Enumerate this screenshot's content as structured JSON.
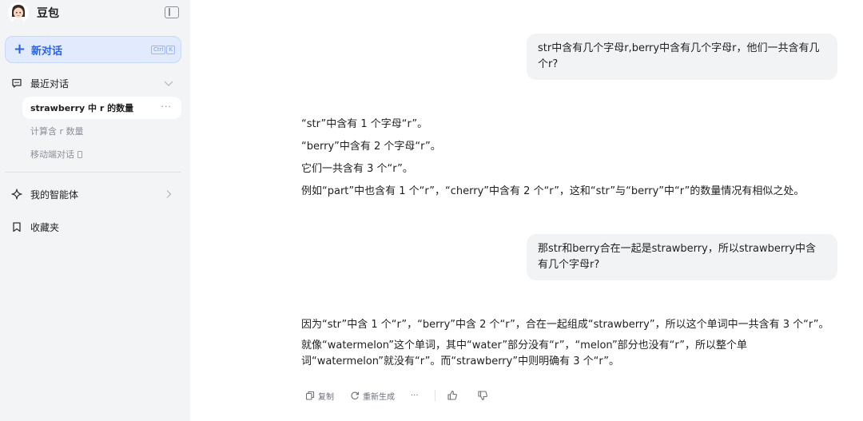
{
  "app": {
    "name": "豆包"
  },
  "sidebar": {
    "new_chat": {
      "label": "新对话",
      "shortcut": [
        "Ctrl",
        "K"
      ]
    },
    "recent": {
      "label": "最近对话",
      "items": [
        {
          "label": "strawberry 中 r 的数量",
          "more": "···"
        },
        {
          "label": "计算含 r 数量"
        },
        {
          "label": "移动端对话"
        }
      ]
    },
    "agents": {
      "label": "我的智能体"
    },
    "favorites": {
      "label": "收藏夹"
    }
  },
  "conversation": {
    "user_1": "str中含有几个字母r,berry中含有几个字母r，他们一共含有几个r?",
    "assistant_1": [
      "“str”中含有 1 个字母“r”。",
      "“berry”中含有 2 个字母“r”。",
      "它们一共含有 3 个“r”。",
      "例如“part”中也含有 1 个“r”，“cherry”中含有 2 个“r”，这和“str”与“berry”中“r”的数量情况有相似之处。"
    ],
    "user_2": "那str和berry合在一起是strawberry，所以strawberry中含有几个字母r?",
    "assistant_2": [
      "因为“str”中含 1 个“r”，“berry”中含 2 个“r”，合在一起组成“strawberry”，所以这个单词中一共含有 3 个“r”。",
      "就像“watermelon”这个单词，其中“water”部分没有“r”，“melon”部分也没有“r”，所以整个单词“watermelon”就没有“r”。而“strawberry”中则明确有 3 个“r”。"
    ]
  },
  "actions": {
    "copy": "复制",
    "regenerate": "重新生成",
    "more": "···"
  },
  "colors": {
    "accent": "#2a62e0",
    "sidebar_bg": "#f3f4f6",
    "bubble_bg": "#f2f3f5"
  }
}
